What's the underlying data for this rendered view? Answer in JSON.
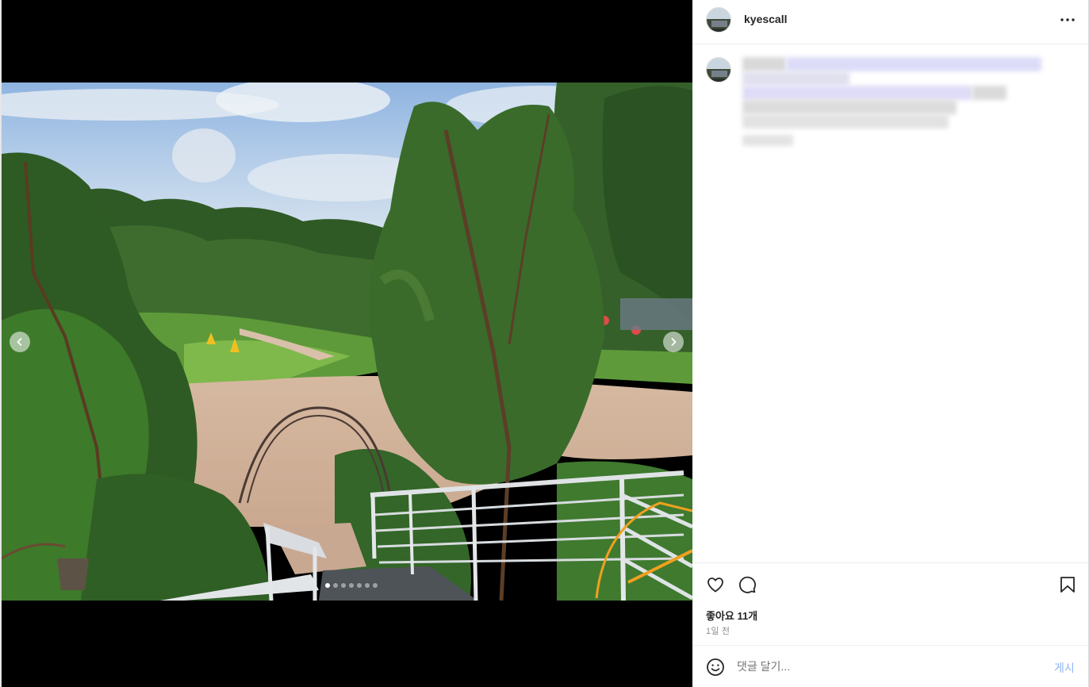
{
  "post": {
    "username": "kyescall",
    "more_icon": "more-horizontal-icon",
    "likes_label": "좋아요 11개",
    "time_label": "1일 전",
    "carousel": {
      "total": 7,
      "current": 1
    }
  },
  "actions": {
    "icons": [
      "heart-icon",
      "comment-icon",
      "bookmark-icon"
    ]
  },
  "comment": {
    "placeholder": "댓글 달기...",
    "post_label": "게시",
    "emoji_icon": "emoji-icon"
  },
  "colors": {
    "text": "#262626",
    "muted": "#8e8e8e",
    "link_disabled": "#8cb4f5",
    "divider": "#efefef"
  }
}
